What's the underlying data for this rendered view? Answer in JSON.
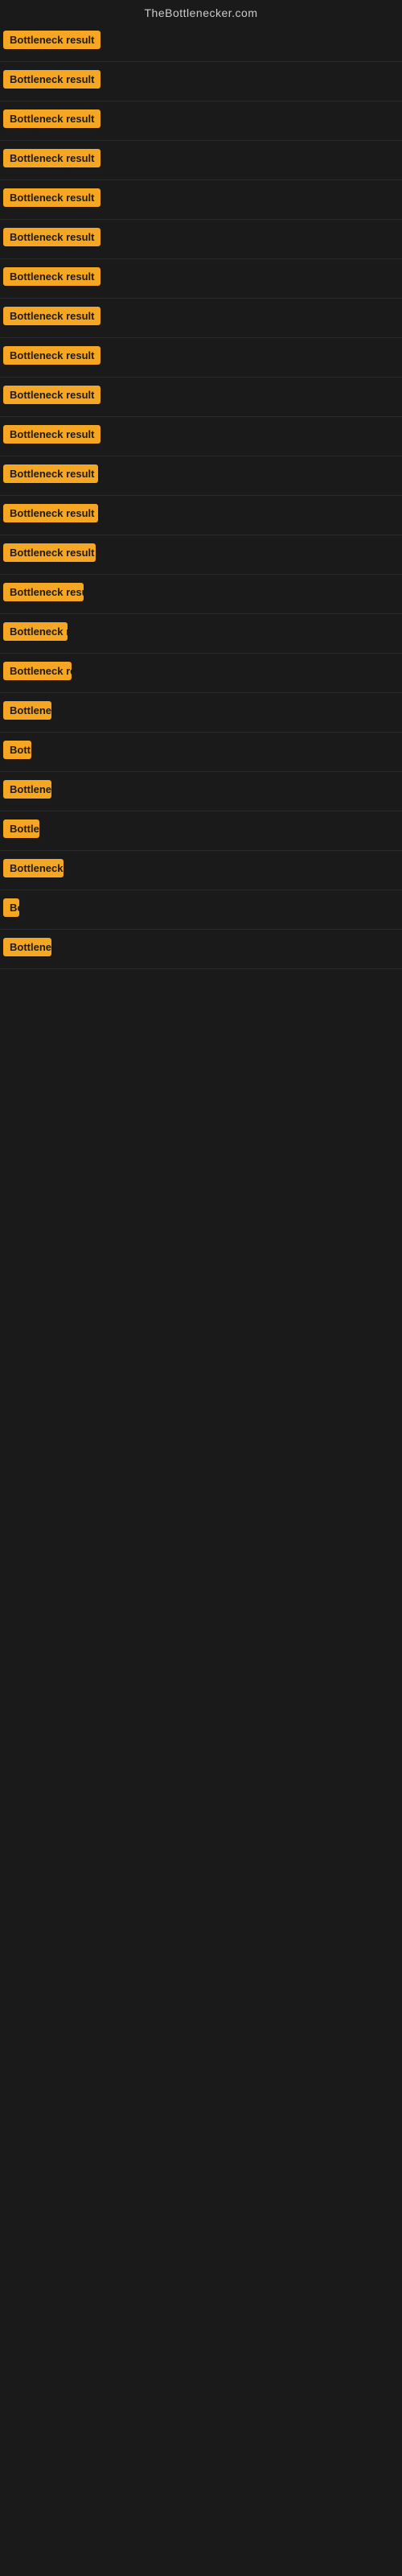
{
  "header": {
    "site_title": "TheBottlenecker.com"
  },
  "badge_label": "Bottleneck result",
  "rows": [
    {
      "id": 1,
      "clip": 130
    },
    {
      "id": 2,
      "clip": 130
    },
    {
      "id": 3,
      "clip": 130
    },
    {
      "id": 4,
      "clip": 130
    },
    {
      "id": 5,
      "clip": 130
    },
    {
      "id": 6,
      "clip": 130
    },
    {
      "id": 7,
      "clip": 130
    },
    {
      "id": 8,
      "clip": 130
    },
    {
      "id": 9,
      "clip": 130
    },
    {
      "id": 10,
      "clip": 130
    },
    {
      "id": 11,
      "clip": 130
    },
    {
      "id": 12,
      "clip": 118
    },
    {
      "id": 13,
      "clip": 118
    },
    {
      "id": 14,
      "clip": 115
    },
    {
      "id": 15,
      "clip": 100
    },
    {
      "id": 16,
      "clip": 80
    },
    {
      "id": 17,
      "clip": 85
    },
    {
      "id": 18,
      "clip": 60
    },
    {
      "id": 19,
      "clip": 35
    },
    {
      "id": 20,
      "clip": 60
    },
    {
      "id": 21,
      "clip": 45
    },
    {
      "id": 22,
      "clip": 75
    },
    {
      "id": 23,
      "clip": 20
    },
    {
      "id": 24,
      "clip": 60
    }
  ]
}
